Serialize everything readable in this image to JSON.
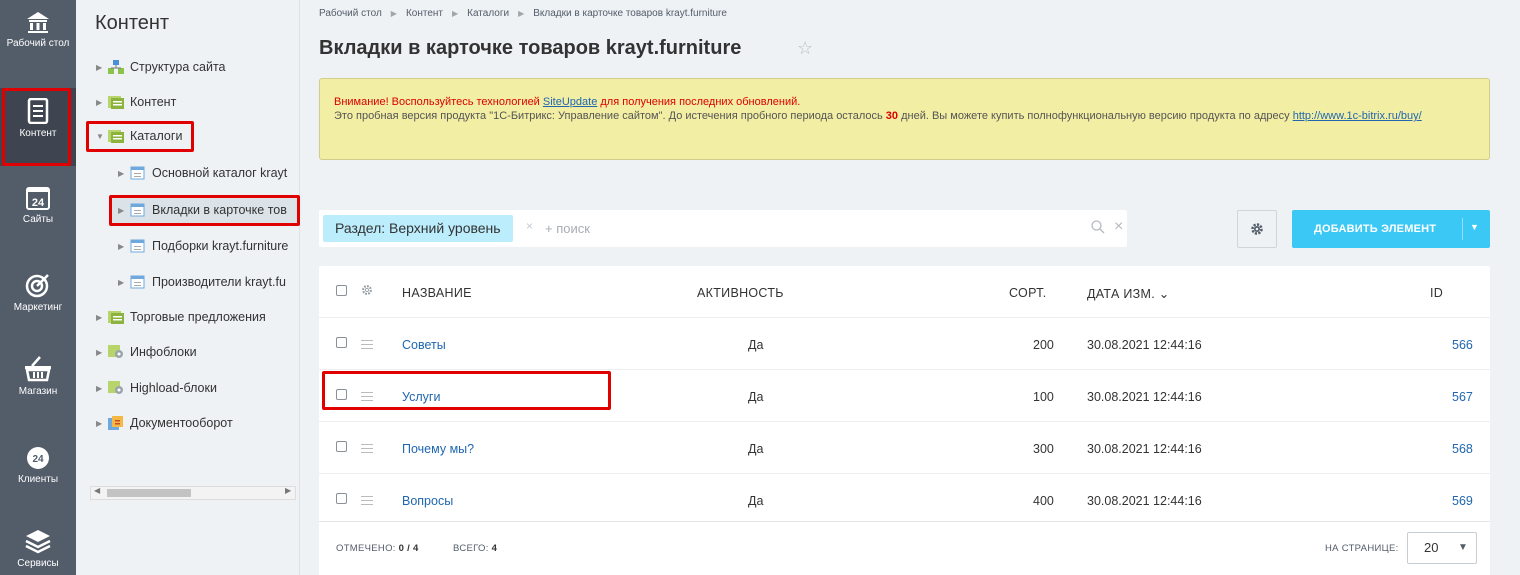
{
  "nav": {
    "items": [
      {
        "label": "Рабочий стол",
        "icon": "home-icon"
      },
      {
        "label": "Контент",
        "icon": "document-icon"
      },
      {
        "label": "Сайты",
        "icon": "calendar-24-icon"
      },
      {
        "label": "Маркетинг",
        "icon": "target-icon"
      },
      {
        "label": "Магазин",
        "icon": "basket-icon"
      },
      {
        "label": "Клиенты",
        "icon": "crm-24-icon"
      },
      {
        "label": "Сервисы",
        "icon": "layers-icon"
      }
    ]
  },
  "tree": {
    "title": "Контент",
    "items": [
      {
        "label": "Структура сайта"
      },
      {
        "label": "Контент"
      },
      {
        "label": "Каталоги"
      },
      {
        "label": "Основной каталог krayt"
      },
      {
        "label": "Вкладки в карточке тов"
      },
      {
        "label": "Подборки krayt.furniture"
      },
      {
        "label": "Производители krayt.fu"
      },
      {
        "label": "Торговые предложения"
      },
      {
        "label": "Инфоблоки"
      },
      {
        "label": "Highload-блоки"
      },
      {
        "label": "Документооборот"
      }
    ]
  },
  "breadcrumb": [
    "Рабочий стол",
    "Контент",
    "Каталоги",
    "Вкладки в карточке товаров krayt.furniture"
  ],
  "page_title": "Вкладки в карточке товаров krayt.furniture",
  "alert": {
    "warning_prefix": "Внимание! Воспользуйтесь технологией ",
    "link1": "SiteUpdate",
    "warning_suffix": " для получения последних обновлений.",
    "line2_a": "Это пробная версия продукта \"1С-Битрикс: Управление сайтом\". До истечения пробного периода осталось ",
    "days": "30",
    "line2_b": " дней. Вы можете купить полнофункциональную версию продукта по адресу ",
    "link2": "http://www.1c-bitrix.ru/buy/"
  },
  "filter": {
    "chip": "Раздел: Верхний уровень",
    "chip_close": "×",
    "placeholder": "+ поиск",
    "clear": "×"
  },
  "toolbar": {
    "add_label": "ДОБАВИТЬ ЭЛЕМЕНТ",
    "add_caret": "▼"
  },
  "grid": {
    "headers": {
      "name": "НАЗВАНИЕ",
      "active": "АКТИВНОСТЬ",
      "sort": "СОРТ.",
      "date": "ДАТА ИЗМ.",
      "date_sort": "⌄",
      "id": "ID"
    },
    "rows": [
      {
        "name": "Советы",
        "active": "Да",
        "sort": "200",
        "date": "30.08.2021 12:44:16",
        "id": "566"
      },
      {
        "name": "Услуги",
        "active": "Да",
        "sort": "100",
        "date": "30.08.2021 12:44:16",
        "id": "567"
      },
      {
        "name": "Почему мы?",
        "active": "Да",
        "sort": "300",
        "date": "30.08.2021 12:44:16",
        "id": "568"
      },
      {
        "name": "Вопросы",
        "active": "Да",
        "sort": "400",
        "date": "30.08.2021 12:44:16",
        "id": "569"
      }
    ],
    "footer": {
      "selected_label": "ОТМЕЧЕНО:",
      "selected_value": "0 / 4",
      "total_label": "ВСЕГО:",
      "total_value": "4",
      "per_page_label": "НА СТРАНИЦЕ:",
      "per_page_value": "20"
    }
  },
  "colors": {
    "accent": "#3bc8f5",
    "sidebar": "#535c69",
    "highlight": "#e00000",
    "link": "#2067b0"
  }
}
